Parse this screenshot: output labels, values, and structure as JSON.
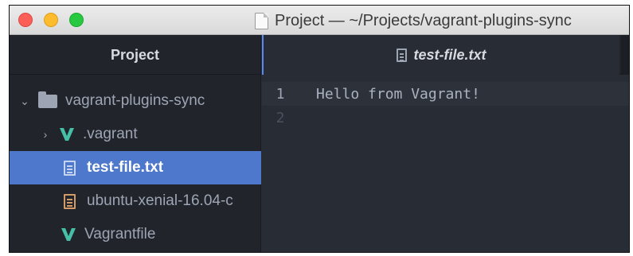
{
  "window": {
    "title": "Project — ~/Projects/vagrant-plugins-sync"
  },
  "sidebar": {
    "title": "Project",
    "root": {
      "label": "vagrant-plugins-sync",
      "icon": "folder-icon",
      "expanded": true
    },
    "items": [
      {
        "label": ".vagrant",
        "icon": "vagrant-icon",
        "type": "folder",
        "expanded": false
      },
      {
        "label": "test-file.txt",
        "icon": "text-file-icon",
        "type": "file",
        "selected": true
      },
      {
        "label": "ubuntu-xenial-16.04-c",
        "icon": "log-file-icon",
        "type": "file"
      },
      {
        "label": "Vagrantfile",
        "icon": "vagrant-icon",
        "type": "file"
      }
    ]
  },
  "tab": {
    "label": "test-file.txt",
    "icon": "text-file-icon"
  },
  "editor": {
    "lines": [
      {
        "number": "1",
        "text": "Hello from Vagrant!"
      },
      {
        "number": "2",
        "text": ""
      }
    ]
  },
  "colors": {
    "selection": "#4d78cc",
    "vagrant": "#45c0a7",
    "log_file": "#d19a66",
    "tab_accent": "#568af2"
  }
}
